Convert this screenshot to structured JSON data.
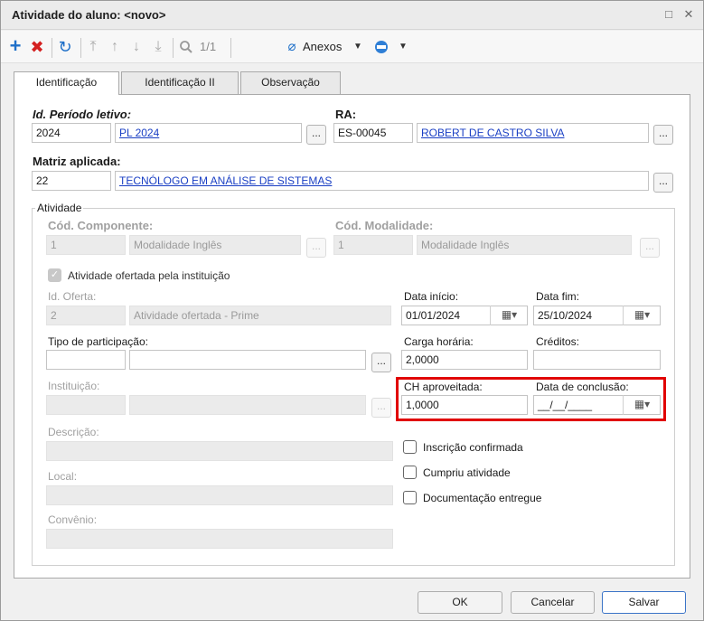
{
  "window": {
    "title": "Atividade do aluno: <novo>",
    "restore_glyph": "□",
    "close_glyph": "✕"
  },
  "toolbar": {
    "record_counter": "1/1",
    "attachments_label": "Anexos",
    "icons": [
      "add-icon",
      "delete-icon",
      "refresh-icon",
      "first-record-icon",
      "previous-record-icon",
      "next-record-icon",
      "last-record-icon",
      "search-icon",
      "paperclip-icon",
      "dropdown-icon",
      "process-icon",
      "dropdown-icon"
    ]
  },
  "tabs": [
    {
      "label": "Identificação",
      "active": true
    },
    {
      "label": "Identificação II",
      "active": false
    },
    {
      "label": "Observação",
      "active": false
    }
  ],
  "form": {
    "periodo": {
      "label": "Id. Período letivo:",
      "code": "2024",
      "name": "PL 2024"
    },
    "ra": {
      "label": "RA:",
      "code": "ES-00045",
      "name": "ROBERT DE CASTRO SILVA"
    },
    "matriz": {
      "label": "Matriz aplicada:",
      "code": "22",
      "name": "TECNÓLOGO EM ANÁLISE DE SISTEMAS"
    },
    "atividade": {
      "group_label": "Atividade",
      "componente": {
        "label": "Cód. Componente:",
        "code": "1",
        "name": "Modalidade Inglês"
      },
      "modalidade": {
        "label": "Cód. Modalidade:",
        "code": "1",
        "name": "Modalidade Inglês"
      },
      "ofertada_label": "Atividade ofertada pela instituição",
      "oferta": {
        "label": "Id. Oferta:",
        "code": "2",
        "name": "Atividade ofertada - Prime"
      },
      "data_inicio": {
        "label": "Data início:",
        "value": "01/01/2024"
      },
      "data_fim": {
        "label": "Data fim:",
        "value": "25/10/2024"
      },
      "tipo_participacao": {
        "label": "Tipo de participação:",
        "code": "",
        "name": ""
      },
      "carga_horaria": {
        "label": "Carga horária:",
        "value": "2,0000"
      },
      "creditos": {
        "label": "Créditos:",
        "value": ""
      },
      "instituicao": {
        "label": "Instituição:"
      },
      "ch_aproveitada": {
        "label": "CH aproveitada:",
        "value": "1,0000"
      },
      "data_conclusao": {
        "label": "Data de conclusão:",
        "value": "__/__/____"
      },
      "descricao": {
        "label": "Descrição:"
      },
      "local": {
        "label": "Local:"
      },
      "convenio": {
        "label": "Convênio:"
      },
      "checks": {
        "inscricao": "Inscrição confirmada",
        "cumpriu": "Cumpriu atividade",
        "documentacao": "Documentação entregue"
      }
    },
    "lookup_label": "..."
  },
  "buttons": {
    "ok": "OK",
    "cancel": "Cancelar",
    "save": "Salvar"
  },
  "colors": {
    "link": "#1a3fc4",
    "add": "#1e6fc8",
    "delete": "#d42020",
    "highlight": "#e10000",
    "primary_border": "#3b74c7"
  }
}
